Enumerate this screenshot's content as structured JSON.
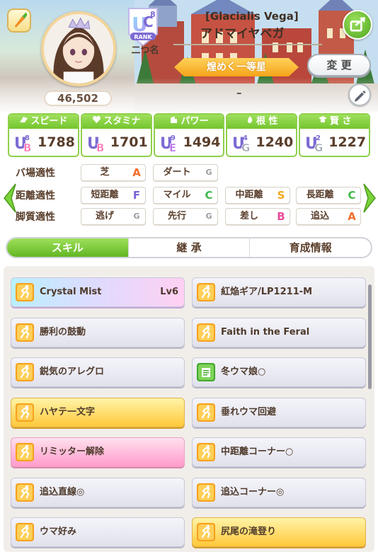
{
  "header": {
    "fan_count": "46,502",
    "rank_label": "RANK",
    "rank_letters": "UC",
    "rank_number": "8",
    "nickname_label": "二つ名",
    "title": "[Glacialis Vega]",
    "name": "アドマイヤベガ",
    "epithet": "煌めく一等星",
    "change_label": "変 更",
    "epithet_dash": "–"
  },
  "stats": [
    {
      "label": "スピード",
      "icon": "speed-icon",
      "grade": "UB",
      "sub": "8",
      "value": "1788"
    },
    {
      "label": "スタミナ",
      "icon": "heart-icon",
      "grade": "UB",
      "sub": "",
      "value": "1701"
    },
    {
      "label": "パワー",
      "icon": "power-icon",
      "grade": "UE",
      "sub": "9",
      "value": "1494"
    },
    {
      "label": "根 性",
      "icon": "flame-icon",
      "grade": "UG",
      "sub": "4",
      "value": "1240"
    },
    {
      "label": "賢 さ",
      "icon": "grad-cap-icon",
      "grade": "UG",
      "sub": "2",
      "value": "1227"
    }
  ],
  "aptitude": {
    "rows": [
      {
        "label": "バ場適性",
        "cells": [
          {
            "name": "芝",
            "grade": "A"
          },
          {
            "name": "ダート",
            "grade": "G"
          }
        ]
      },
      {
        "label": "距離適性",
        "cells": [
          {
            "name": "短距離",
            "grade": "F"
          },
          {
            "name": "マイル",
            "grade": "C"
          },
          {
            "name": "中距離",
            "grade": "S"
          },
          {
            "name": "長距離",
            "grade": "C"
          }
        ]
      },
      {
        "label": "脚質適性",
        "cells": [
          {
            "name": "逃げ",
            "grade": "G"
          },
          {
            "name": "先行",
            "grade": "G"
          },
          {
            "name": "差し",
            "grade": "B"
          },
          {
            "name": "追込",
            "grade": "A"
          }
        ]
      }
    ]
  },
  "tabs": [
    "スキル",
    "継 承",
    "育成情報"
  ],
  "skills": [
    {
      "name": "Crystal Mist",
      "level": "Lv6",
      "style": "rainbow",
      "icon": "runner-icon"
    },
    {
      "name": "紅焔ギア/LP1211-M",
      "level": "",
      "style": "normal",
      "icon": "runner-icon"
    },
    {
      "name": "勝利の鼓動",
      "level": "",
      "style": "normal",
      "icon": "runner-icon"
    },
    {
      "name": "Faith in the Feral",
      "level": "",
      "style": "normal",
      "icon": "runner-icon"
    },
    {
      "name": "鋭気のアレグロ",
      "level": "",
      "style": "normal",
      "icon": "runner-icon"
    },
    {
      "name": "冬ウマ娘○",
      "level": "",
      "style": "normal",
      "icon": "green-book-icon"
    },
    {
      "name": "ハヤテ一文字",
      "level": "",
      "style": "gold",
      "icon": "runner-icon"
    },
    {
      "name": "垂れウマ回避",
      "level": "",
      "style": "normal",
      "icon": "runner-icon"
    },
    {
      "name": "リミッター解除",
      "level": "",
      "style": "pink",
      "icon": "runner-icon"
    },
    {
      "name": "中距離コーナー○",
      "level": "",
      "style": "normal",
      "icon": "runner-icon"
    },
    {
      "name": "追込直線◎",
      "level": "",
      "style": "normal",
      "icon": "runner-icon"
    },
    {
      "name": "追込コーナー◎",
      "level": "",
      "style": "normal",
      "icon": "runner-icon"
    },
    {
      "name": "ウマ好み",
      "level": "",
      "style": "normal",
      "icon": "runner-icon"
    },
    {
      "name": "尻尾の滝登り",
      "level": "",
      "style": "gold",
      "icon": "runner-icon"
    }
  ],
  "colors": {
    "accent_green": "#74c52f",
    "grade_A": "#f26d2c",
    "grade_S": "#f0a81c",
    "grade_B": "#e94b9a",
    "grade_C": "#3db94a",
    "grade_F": "#7b63d6",
    "grade_G": "#9a9a9a",
    "epithet_gold": "#f5a419"
  }
}
